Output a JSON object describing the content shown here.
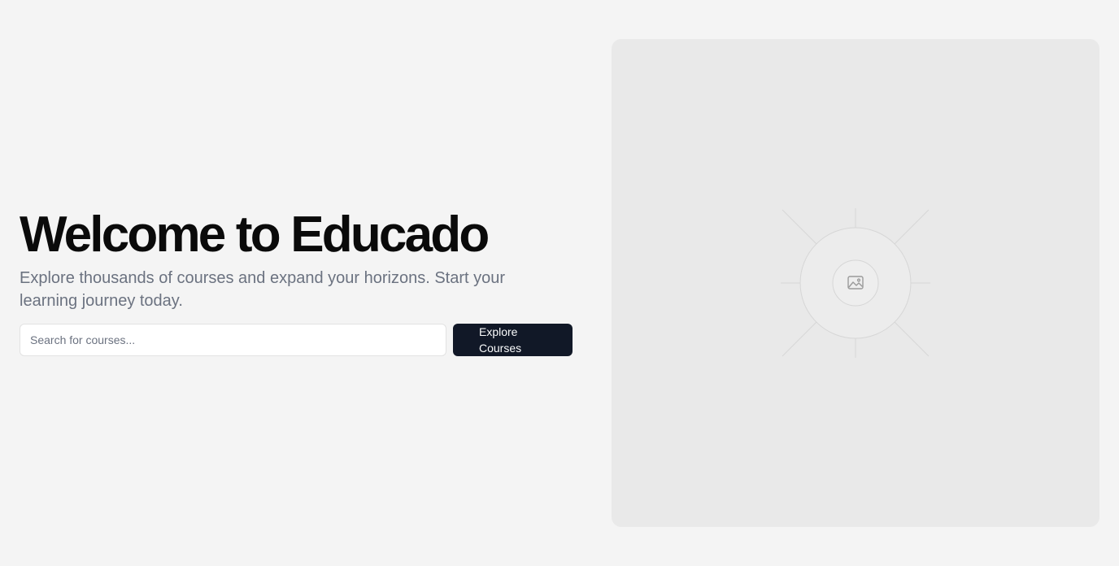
{
  "hero": {
    "title": "Welcome to Educado",
    "subtitle": "Explore thousands of courses and expand your horizons. Start your learning journey today."
  },
  "search": {
    "placeholder": "Search for courses...",
    "value": ""
  },
  "cta": {
    "label": "Explore Courses"
  },
  "media": {
    "icon": "image-icon"
  },
  "colors": {
    "background": "#f4f4f4",
    "title": "#0a0a0a",
    "subtitle": "#6b7280",
    "button_bg": "#111827",
    "button_text": "#f9fafb",
    "placeholder_bg": "#e9e9e9"
  }
}
